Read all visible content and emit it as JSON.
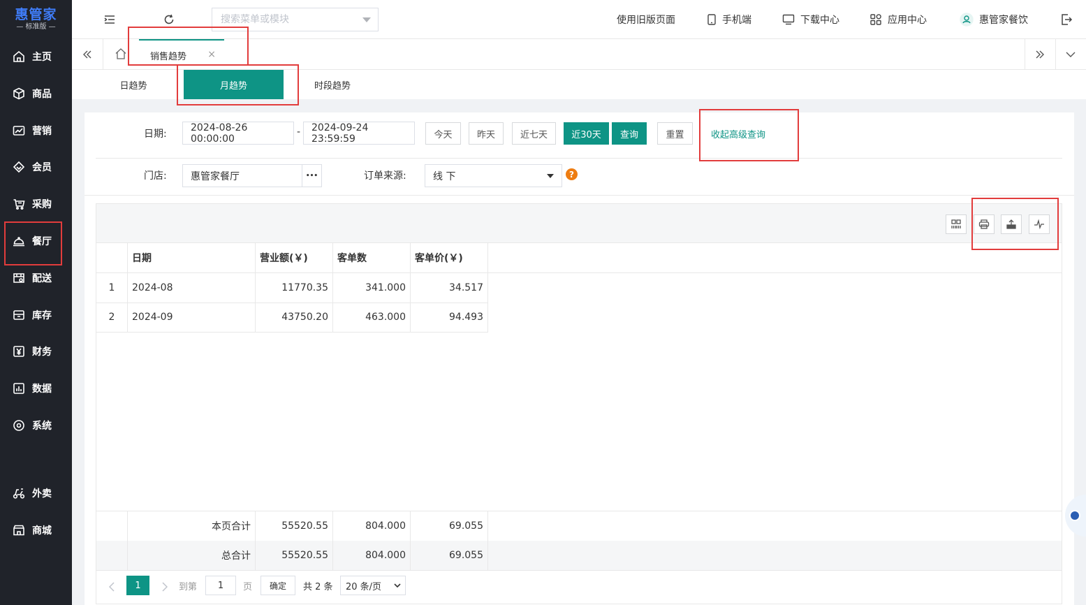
{
  "sidebar": {
    "logo": "惠管家",
    "logo_sub": "— 标准版 —",
    "items": [
      {
        "label": "主页",
        "icon": "home-icon"
      },
      {
        "label": "商品",
        "icon": "cube-icon"
      },
      {
        "label": "营销",
        "icon": "chart-line-icon"
      },
      {
        "label": "会员",
        "icon": "diamond-icon"
      },
      {
        "label": "采购",
        "icon": "cart-icon"
      },
      {
        "label": "餐厅",
        "icon": "cloche-icon"
      },
      {
        "label": "配送",
        "icon": "store-icon"
      },
      {
        "label": "库存",
        "icon": "inventory-icon"
      },
      {
        "label": "财务",
        "icon": "yuan-icon"
      },
      {
        "label": "数据",
        "icon": "data-chart-icon"
      },
      {
        "label": "系统",
        "icon": "settings-icon"
      },
      {
        "label": "外卖",
        "icon": "scooter-icon"
      },
      {
        "label": "商城",
        "icon": "shop-icon"
      }
    ]
  },
  "header": {
    "search_placeholder": "搜索菜单或模块",
    "links": {
      "old_page": "使用旧版页面",
      "mobile": "手机端",
      "download": "下载中心",
      "apps": "应用中心",
      "user": "惠管家餐饮"
    }
  },
  "tabs": {
    "active_label": "销售趋势",
    "close_glyph": "×"
  },
  "subtabs": [
    "日趋势",
    "月趋势",
    "时段趋势"
  ],
  "query": {
    "date_label": "日期:",
    "date_start": "2024-08-26 00:00:00",
    "date_sep": "-",
    "date_end": "2024-09-24 23:59:59",
    "quick": [
      "今天",
      "昨天",
      "近七天",
      "近30天"
    ],
    "search_btn": "查询",
    "reset_btn": "重置",
    "collapse_link": "收起高级查询",
    "store_label": "门店:",
    "store_value": "惠管家餐厅",
    "store_more": "•••",
    "source_label": "订单来源:",
    "source_value": "线 下",
    "help": "?"
  },
  "table": {
    "columns": [
      "日期",
      "营业额(￥)",
      "客单数",
      "客单价(￥)"
    ],
    "rows": [
      {
        "idx": "1",
        "date": "2024-08",
        "revenue": "11770.35",
        "orders": "341.000",
        "avg": "34.517"
      },
      {
        "idx": "2",
        "date": "2024-09",
        "revenue": "43750.20",
        "orders": "463.000",
        "avg": "94.493"
      }
    ],
    "page_total": {
      "label": "本页合计",
      "revenue": "55520.55",
      "orders": "804.000",
      "avg": "69.055"
    },
    "grand_total": {
      "label": "总合计",
      "revenue": "55520.55",
      "orders": "804.000",
      "avg": "69.055"
    }
  },
  "pager": {
    "current": "1",
    "goto": "到第",
    "goto_value": "1",
    "page_unit": "页",
    "confirm": "确定",
    "total": "共 2 条",
    "page_size": "20 条/页"
  },
  "colors": {
    "accent": "#0e9485",
    "sidebar_bg": "#20232a",
    "annotation": "#e23c3c",
    "help": "#ee7d12"
  }
}
